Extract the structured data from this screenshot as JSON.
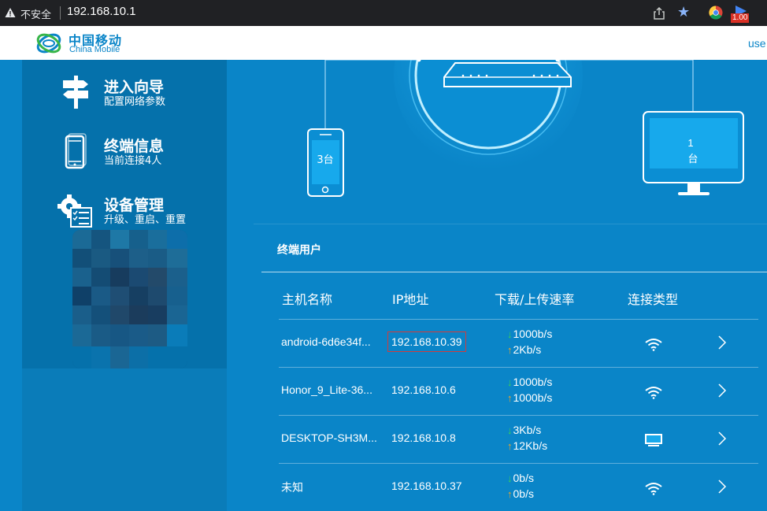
{
  "browser": {
    "insecure_label": "不安全",
    "url": "192.168.10.1",
    "ext_badge": "1.00"
  },
  "header": {
    "logo_cn": "中国移动",
    "logo_en": "China Mobile",
    "user_link": "use"
  },
  "sidebar": {
    "items": [
      {
        "title": "进入向导",
        "subtitle": "配置网络参数",
        "icon": "signpost-icon"
      },
      {
        "title": "终端信息",
        "subtitle": "当前连接4人",
        "icon": "phone-icon"
      },
      {
        "title": "设备管理",
        "subtitle": "升级、重启、重置",
        "icon": "gear-checklist-icon"
      }
    ]
  },
  "diagram": {
    "phone_count": "3台",
    "pc_count": "1",
    "pc_unit": "台"
  },
  "table": {
    "title": "终端用户",
    "headers": [
      "主机名称",
      "IP地址",
      "下载/上传速率",
      "连接类型"
    ],
    "rows": [
      {
        "name": "android-6d6e34f...",
        "ip": "192.168.10.39",
        "down": "1000b/s",
        "up": "2Kb/s",
        "conn": "wifi-icon",
        "highlighted": true
      },
      {
        "name": "Honor_9_Lite-36...",
        "ip": "192.168.10.6",
        "down": "1000b/s",
        "up": "1000b/s",
        "conn": "wifi-icon",
        "highlighted": false
      },
      {
        "name": "DESKTOP-SH3M...",
        "ip": "192.168.10.8",
        "down": "3Kb/s",
        "up": "12Kb/s",
        "conn": "monitor-icon",
        "highlighted": false
      },
      {
        "name": "未知",
        "ip": "192.168.10.37",
        "down": "0b/s",
        "up": "0b/s",
        "conn": "wifi-icon",
        "highlighted": false
      }
    ]
  },
  "arrows": {
    "down": "↓",
    "up": "↑"
  }
}
